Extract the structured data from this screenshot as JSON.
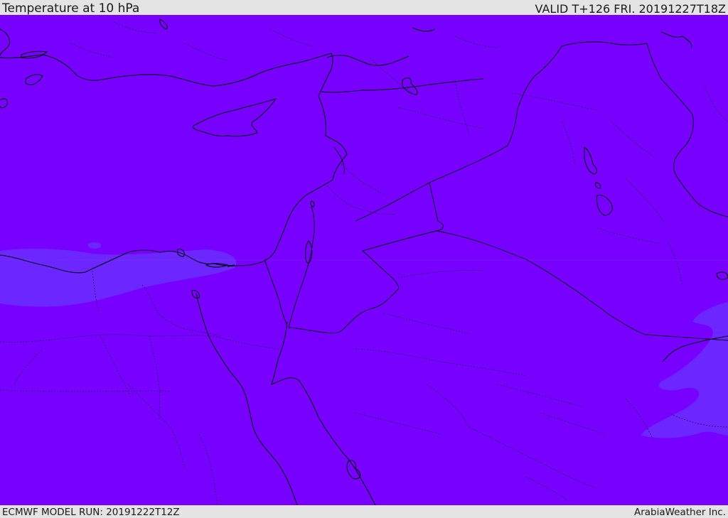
{
  "header": {
    "title": "Temperature at 10 hPa",
    "valid": "VALID T+126 FRI. 20191227T18Z"
  },
  "footer": {
    "model_run": "ECMWF MODEL RUN: 20191222T12Z",
    "credit": "ArabiaWeather Inc."
  },
  "colors": {
    "field_main": "#7700ff",
    "field_cooler": "#6a2dff",
    "coastline": "#000000",
    "border": "#2a0055",
    "frame": "#e4e4e4"
  },
  "map": {
    "region": "Eastern Mediterranean and Middle East",
    "variable": "temperature",
    "level": "10 hPa"
  }
}
